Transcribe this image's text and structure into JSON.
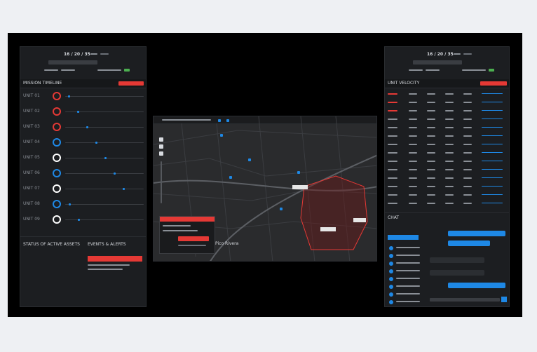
{
  "left_panel": {
    "time": "16 / 20 / 35",
    "section_title": "MISSION TIMELINE",
    "unit_rows": [
      "UNIT 01",
      "UNIT 02",
      "UNIT 03",
      "UNIT 04",
      "UNIT 05",
      "UNIT 06",
      "UNIT 07",
      "UNIT 08",
      "UNIT 09"
    ],
    "bottom_left_title": "STATUS OF ACTIVE ASSETS",
    "bottom_right_title": "EVENTS & ALERTS"
  },
  "map": {
    "header": "",
    "place_label": "Pico Rivera",
    "callouts": [
      "",
      "",
      ""
    ]
  },
  "right_panel": {
    "time": "16 / 20 / 35",
    "section_title": "UNIT VELOCITY",
    "rows": 14,
    "chat_title": "CHAT"
  },
  "colors": {
    "accent_red": "#e53935",
    "accent_blue": "#1e88e5",
    "panel": "#1c1e21",
    "stage": "#000000",
    "page": "#eef0f3"
  }
}
